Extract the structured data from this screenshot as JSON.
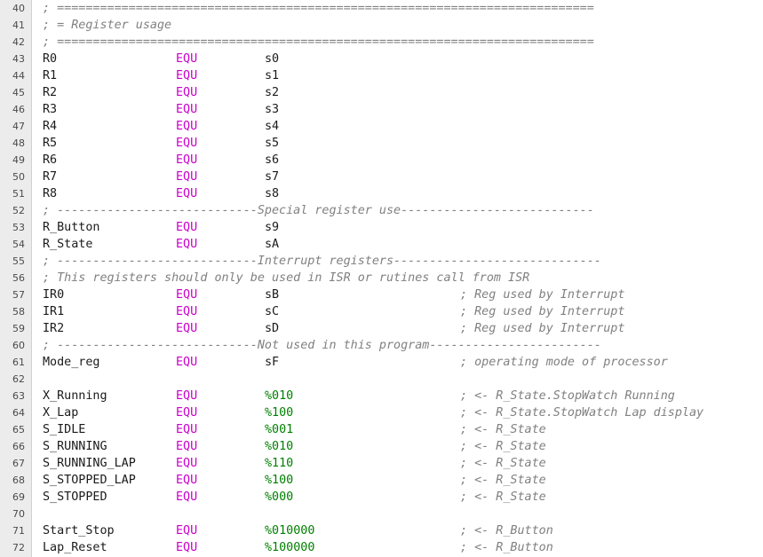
{
  "colors": {
    "gutter_bg": "#ececec",
    "comment": "#808080",
    "keyword": "#cc00cc",
    "number": "#008000",
    "text": "#1a1a1a"
  },
  "lines": [
    {
      "n": "40",
      "comment": "; ==========================================================================="
    },
    {
      "n": "41",
      "comment": "; = Register usage"
    },
    {
      "n": "42",
      "comment": "; ==========================================================================="
    },
    {
      "n": "43",
      "label": "R0",
      "kw": "EQU",
      "val": "s0"
    },
    {
      "n": "44",
      "label": "R1",
      "kw": "EQU",
      "val": "s1"
    },
    {
      "n": "45",
      "label": "R2",
      "kw": "EQU",
      "val": "s2"
    },
    {
      "n": "46",
      "label": "R3",
      "kw": "EQU",
      "val": "s3"
    },
    {
      "n": "47",
      "label": "R4",
      "kw": "EQU",
      "val": "s4"
    },
    {
      "n": "48",
      "label": "R5",
      "kw": "EQU",
      "val": "s5"
    },
    {
      "n": "49",
      "label": "R6",
      "kw": "EQU",
      "val": "s6"
    },
    {
      "n": "50",
      "label": "R7",
      "kw": "EQU",
      "val": "s7"
    },
    {
      "n": "51",
      "label": "R8",
      "kw": "EQU",
      "val": "s8"
    },
    {
      "n": "52",
      "comment": "; ----------------------------Special register use---------------------------"
    },
    {
      "n": "53",
      "label": "R_Button",
      "kw": "EQU",
      "val": "s9"
    },
    {
      "n": "54",
      "label": "R_State",
      "kw": "EQU",
      "val": "sA"
    },
    {
      "n": "55",
      "comment": "; ----------------------------Interrupt registers-----------------------------"
    },
    {
      "n": "56",
      "comment": "; This registers should only be used in ISR or rutines call from ISR"
    },
    {
      "n": "57",
      "label": "IR0",
      "kw": "EQU",
      "val": "sB",
      "rc": "; Reg used by Interrupt"
    },
    {
      "n": "58",
      "label": "IR1",
      "kw": "EQU",
      "val": "sC",
      "rc": "; Reg used by Interrupt"
    },
    {
      "n": "59",
      "label": "IR2",
      "kw": "EQU",
      "val": "sD",
      "rc": "; Reg used by Interrupt"
    },
    {
      "n": "60",
      "comment": "; ----------------------------Not used in this program------------------------"
    },
    {
      "n": "61",
      "label": "Mode_reg",
      "kw": "EQU",
      "val": "sF",
      "rc": "; operating mode of processor"
    },
    {
      "n": "62"
    },
    {
      "n": "63",
      "label": "X_Running",
      "kw": "EQU",
      "val": "%010",
      "num": true,
      "rc": "; <- R_State.StopWatch Running"
    },
    {
      "n": "64",
      "label": "X_Lap",
      "kw": "EQU",
      "val": "%100",
      "num": true,
      "rc": "; <- R_State.StopWatch Lap display"
    },
    {
      "n": "65",
      "label": "S_IDLE",
      "kw": "EQU",
      "val": "%001",
      "num": true,
      "rc": "; <- R_State"
    },
    {
      "n": "66",
      "label": "S_RUNNING",
      "kw": "EQU",
      "val": "%010",
      "num": true,
      "rc": "; <- R_State"
    },
    {
      "n": "67",
      "label": "S_RUNNING_LAP",
      "kw": "EQU",
      "val": "%110",
      "num": true,
      "rc": "; <- R_State"
    },
    {
      "n": "68",
      "label": "S_STOPPED_LAP",
      "kw": "EQU",
      "val": "%100",
      "num": true,
      "rc": "; <- R_State"
    },
    {
      "n": "69",
      "label": "S_STOPPED",
      "kw": "EQU",
      "val": "%000",
      "num": true,
      "rc": "; <- R_State"
    },
    {
      "n": "70"
    },
    {
      "n": "71",
      "label": "Start_Stop",
      "kw": "EQU",
      "val": "%010000",
      "num": true,
      "rc": "; <- R_Button"
    },
    {
      "n": "72",
      "label": "Lap_Reset",
      "kw": "EQU",
      "val": "%100000",
      "num": true,
      "rc": "; <- R_Button"
    }
  ]
}
